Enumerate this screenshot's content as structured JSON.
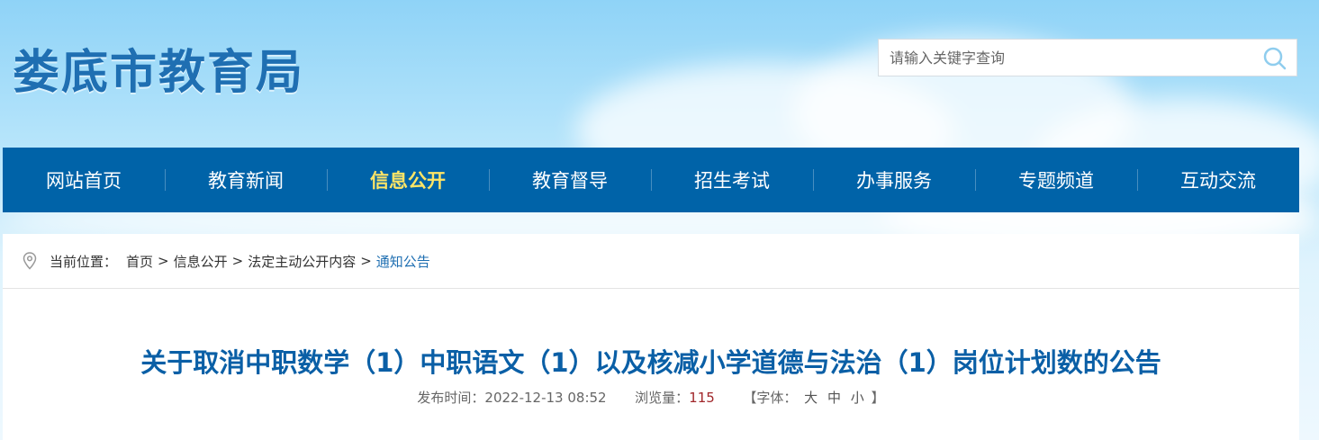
{
  "header": {
    "site_title": "娄底市教育局",
    "search": {
      "placeholder": "请输入关键字查询",
      "icon": "search-icon"
    }
  },
  "nav": {
    "items": [
      {
        "label": "网站首页",
        "active": false
      },
      {
        "label": "教育新闻",
        "active": false
      },
      {
        "label": "信息公开",
        "active": true
      },
      {
        "label": "教育督导",
        "active": false
      },
      {
        "label": "招生考试",
        "active": false
      },
      {
        "label": "办事服务",
        "active": false
      },
      {
        "label": "专题频道",
        "active": false
      },
      {
        "label": "互动交流",
        "active": false
      }
    ],
    "background_color": "#0063a8",
    "active_color": "#ffe566"
  },
  "breadcrumb": {
    "icon": "location-pin-icon",
    "prefix": "当前位置：",
    "items": [
      "首页",
      "信息公开",
      "法定主动公开内容",
      "通知公告"
    ],
    "separator": ">"
  },
  "article": {
    "title": "关于取消中职数学（1）中职语文（1）以及核减小学道德与法治（1）岗位计划数的公告",
    "publish_label": "发布时间：",
    "publish_time": "2022-12-13 08:52",
    "views_label": "浏览量：",
    "views": "115",
    "font_label_open": "【字体：",
    "font_options": [
      "大",
      "中",
      "小"
    ],
    "font_label_close": "】",
    "title_color": "#0a5fa6"
  }
}
